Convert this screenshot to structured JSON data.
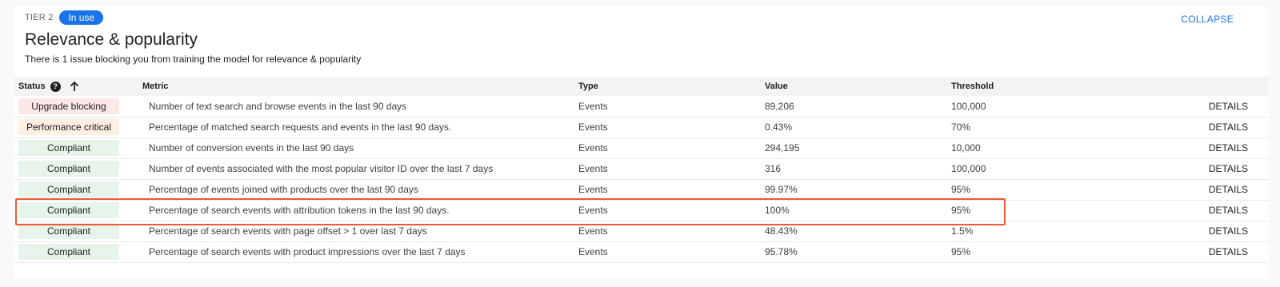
{
  "header": {
    "tier_label": "TIER 2",
    "badge": "In use",
    "collapse": "COLLAPSE",
    "title": "Relevance & popularity",
    "subtitle": "There is 1 issue blocking you from training the model for relevance & popularity"
  },
  "table": {
    "columns": {
      "status": "Status",
      "metric": "Metric",
      "type": "Type",
      "value": "Value",
      "threshold": "Threshold"
    },
    "help_glyph": "?",
    "rows": [
      {
        "status": "Upgrade blocking",
        "metric": "Number of text search and browse events in the last 90 days",
        "type": "Events",
        "value": "89,206",
        "threshold": "100,000",
        "action": "DETAILS"
      },
      {
        "status": "Performance critical",
        "metric": "Percentage of matched search requests and events in the last 90 days.",
        "type": "Events",
        "value": "0.43%",
        "threshold": "70%",
        "action": "DETAILS"
      },
      {
        "status": "Compliant",
        "metric": "Number of conversion events in the last 90 days",
        "type": "Events",
        "value": "294,195",
        "threshold": "10,000",
        "action": "DETAILS"
      },
      {
        "status": "Compliant",
        "metric": "Number of events associated with the most popular visitor ID over the last 7 days",
        "type": "Events",
        "value": "316",
        "threshold": "100,000",
        "action": "DETAILS"
      },
      {
        "status": "Compliant",
        "metric": "Percentage of events joined with products over the last 90 days",
        "type": "Events",
        "value": "99.97%",
        "threshold": "95%",
        "action": "DETAILS"
      },
      {
        "status": "Compliant",
        "metric": "Percentage of search events with attribution tokens in the last 90 days.",
        "type": "Events",
        "value": "100%",
        "threshold": "95%",
        "action": "DETAILS"
      },
      {
        "status": "Compliant",
        "metric": "Percentage of search events with page offset > 1 over last 7 days",
        "type": "Events",
        "value": "48.43%",
        "threshold": "1.5%",
        "action": "DETAILS"
      },
      {
        "status": "Compliant",
        "metric": "Percentage of search events with product impressions over the last 7 days",
        "type": "Events",
        "value": "95.78%",
        "threshold": "95%",
        "action": "DETAILS"
      }
    ]
  },
  "colors": {
    "accent": "#1a73e8",
    "upgrade_blocking": "#fce8e6",
    "performance_critical": "#feefe3",
    "compliant": "#e6f4ea",
    "highlight": "#ee5a36"
  },
  "icons": {
    "help": "help-icon",
    "sort": "arrow-up-icon"
  }
}
